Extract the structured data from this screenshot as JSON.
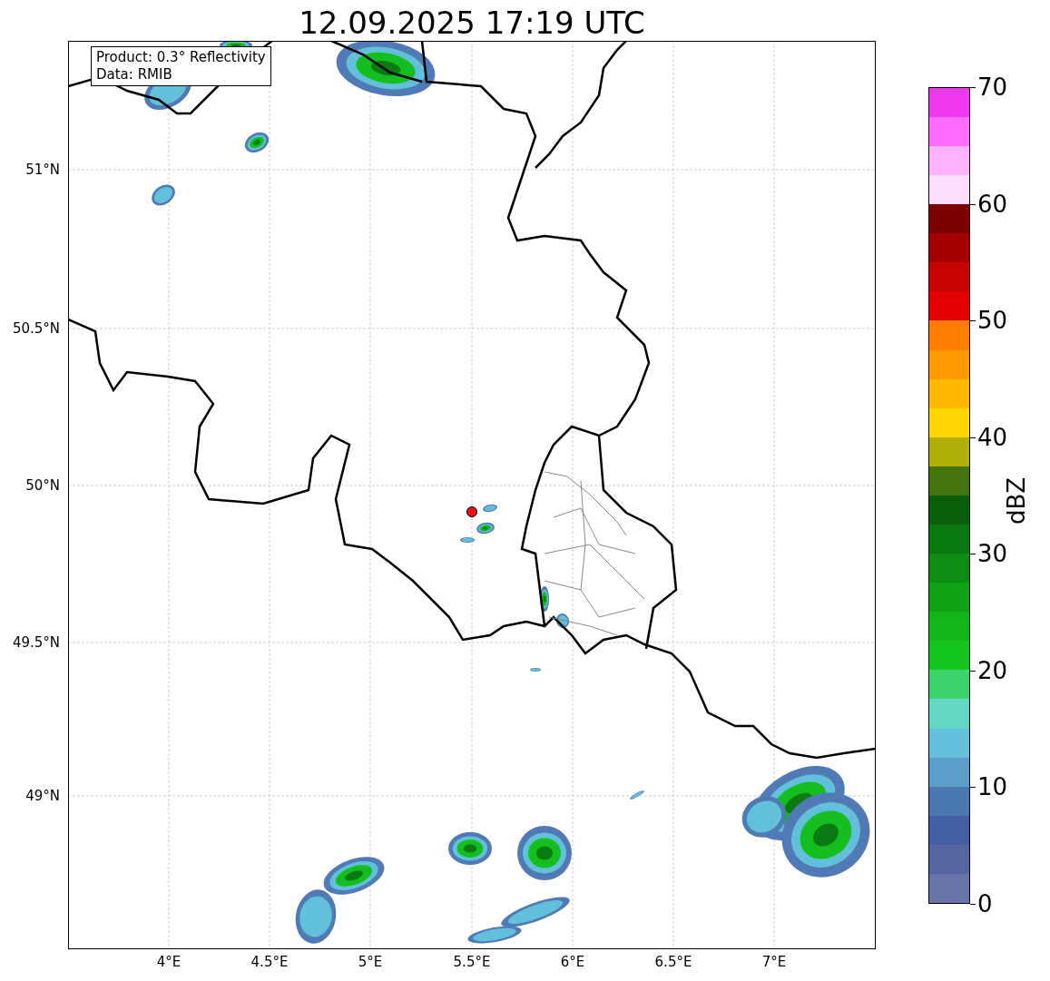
{
  "title": "12.09.2025 17:19 UTC",
  "map": {
    "info_box": [
      "Product: 0.3° Reflectivity",
      "Data: RMIB"
    ],
    "lat_ticks": [
      "51°N",
      "50.5°N",
      "50°N",
      "49.5°N",
      "49°N"
    ],
    "lon_ticks": [
      "4°E",
      "4.5°E",
      "5°E",
      "5.5°E",
      "6°E",
      "6.5°E",
      "7°E"
    ]
  },
  "colorbar": {
    "label": "dBZ",
    "ticks": [
      "70",
      "60",
      "50",
      "40",
      "30",
      "20",
      "10",
      "0"
    ]
  }
}
